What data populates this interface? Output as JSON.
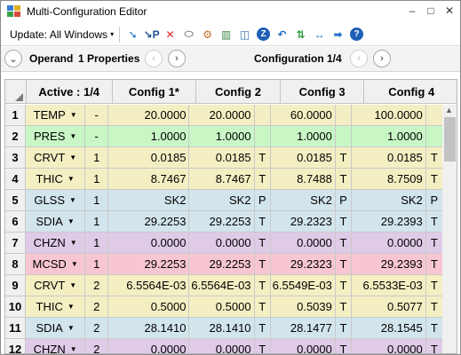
{
  "window": {
    "title": "Multi-Configuration Editor",
    "minimize": "–",
    "restore": "□",
    "close": "✕"
  },
  "toolbar": {
    "update_label": "Update: All Windows",
    "update_caret": "▾",
    "tools": [
      {
        "name": "insert-operand-icon",
        "glyph": "➘",
        "color": "#1f6fc5"
      },
      {
        "name": "insert-after-icon",
        "glyph": "↘P",
        "color": "#1f4f8f"
      },
      {
        "name": "delete-operand-icon",
        "glyph": "✕",
        "color": "#d92020"
      },
      {
        "name": "clear-icon",
        "glyph": "⬭",
        "color": "#888888"
      },
      {
        "name": "settings-icon",
        "glyph": "⚙",
        "color": "#c07020"
      },
      {
        "name": "columns-icon",
        "glyph": "▥",
        "color": "#3a8a4a"
      },
      {
        "name": "graph-icon",
        "glyph": "◫",
        "color": "#2a6ab0"
      },
      {
        "name": "zoom-icon",
        "glyph": "Z",
        "color": "#ffffff"
      },
      {
        "name": "undo-icon",
        "glyph": "↶",
        "color": "#1f6fc5"
      },
      {
        "name": "swap-icon",
        "glyph": "⇅",
        "color": "#2e9e3e"
      },
      {
        "name": "expand-icon",
        "glyph": "↔",
        "color": "#1f6fc5"
      },
      {
        "name": "arrow-right-icon",
        "glyph": "➡",
        "color": "#1f6fc5"
      },
      {
        "name": "help-icon",
        "glyph": "?",
        "color": "#ffffff"
      }
    ]
  },
  "nav": {
    "operand_label": "Operand",
    "properties_label": "1 Properties",
    "configuration_label": "Configuration 1/4",
    "collapse_glyph": "⌄",
    "prev_glyph": "‹",
    "next_glyph": "›"
  },
  "grid": {
    "headers": {
      "active": "Active : 1/4",
      "c1": "Config 1*",
      "c2": "Config 2",
      "c3": "Config 3",
      "c4": "Config 4"
    },
    "rows": [
      {
        "num": "1",
        "op": "TEMP",
        "active": "-",
        "c1": "20.0000",
        "f1": "",
        "c2": "20.0000",
        "f2": "",
        "c3": "60.0000",
        "f3": "",
        "c4": "100.0000",
        "f4": "",
        "color": "#f3efc3"
      },
      {
        "num": "2",
        "op": "PRES",
        "active": "-",
        "c1": "1.0000",
        "f1": "",
        "c2": "1.0000",
        "f2": "",
        "c3": "1.0000",
        "f3": "",
        "c4": "1.0000",
        "f4": "",
        "color": "#c8f7c5"
      },
      {
        "num": "3",
        "op": "CRVT",
        "active": "1",
        "c1": "0.0185",
        "f1": "",
        "c2": "0.0185",
        "f2": "T",
        "c3": "0.0185",
        "f3": "T",
        "c4": "0.0185",
        "f4": "T",
        "color": "#f3efc3"
      },
      {
        "num": "4",
        "op": "THIC",
        "active": "1",
        "c1": "8.7467",
        "f1": "",
        "c2": "8.7467",
        "f2": "T",
        "c3": "8.7488",
        "f3": "T",
        "c4": "8.7509",
        "f4": "T",
        "color": "#f3efc3"
      },
      {
        "num": "5",
        "op": "GLSS",
        "active": "1",
        "c1": "SK2",
        "f1": "",
        "c2": "SK2",
        "f2": "P",
        "c3": "SK2",
        "f3": "P",
        "c4": "SK2",
        "f4": "P",
        "color": "#d3e5ec"
      },
      {
        "num": "6",
        "op": "SDIA",
        "active": "1",
        "c1": "29.2253",
        "f1": "",
        "c2": "29.2253",
        "f2": "T",
        "c3": "29.2323",
        "f3": "T",
        "c4": "29.2393",
        "f4": "T",
        "color": "#d3e5ec"
      },
      {
        "num": "7",
        "op": "CHZN",
        "active": "1",
        "c1": "0.0000",
        "f1": "",
        "c2": "0.0000",
        "f2": "T",
        "c3": "0.0000",
        "f3": "T",
        "c4": "0.0000",
        "f4": "T",
        "color": "#dfcbe8"
      },
      {
        "num": "8",
        "op": "MCSD",
        "active": "1",
        "c1": "29.2253",
        "f1": "",
        "c2": "29.2253",
        "f2": "T",
        "c3": "29.2323",
        "f3": "T",
        "c4": "29.2393",
        "f4": "T",
        "color": "#f7c6d1"
      },
      {
        "num": "9",
        "op": "CRVT",
        "active": "2",
        "c1": "6.5564E-03",
        "f1": "",
        "c2": "6.5564E-03",
        "f2": "T",
        "c3": "6.5549E-03",
        "f3": "T",
        "c4": "6.5533E-03",
        "f4": "T",
        "color": "#f3efc3"
      },
      {
        "num": "10",
        "op": "THIC",
        "active": "2",
        "c1": "0.5000",
        "f1": "",
        "c2": "0.5000",
        "f2": "T",
        "c3": "0.5039",
        "f3": "T",
        "c4": "0.5077",
        "f4": "T",
        "color": "#f3efc3"
      },
      {
        "num": "11",
        "op": "SDIA",
        "active": "2",
        "c1": "28.1410",
        "f1": "",
        "c2": "28.1410",
        "f2": "T",
        "c3": "28.1477",
        "f3": "T",
        "c4": "28.1545",
        "f4": "T",
        "color": "#d3e5ec"
      },
      {
        "num": "12",
        "op": "CHZN",
        "active": "2",
        "c1": "0.0000",
        "f1": "",
        "c2": "0.0000",
        "f2": "T",
        "c3": "0.0000",
        "f3": "T",
        "c4": "0.0000",
        "f4": "T",
        "color": "#dfcbe8"
      }
    ]
  }
}
